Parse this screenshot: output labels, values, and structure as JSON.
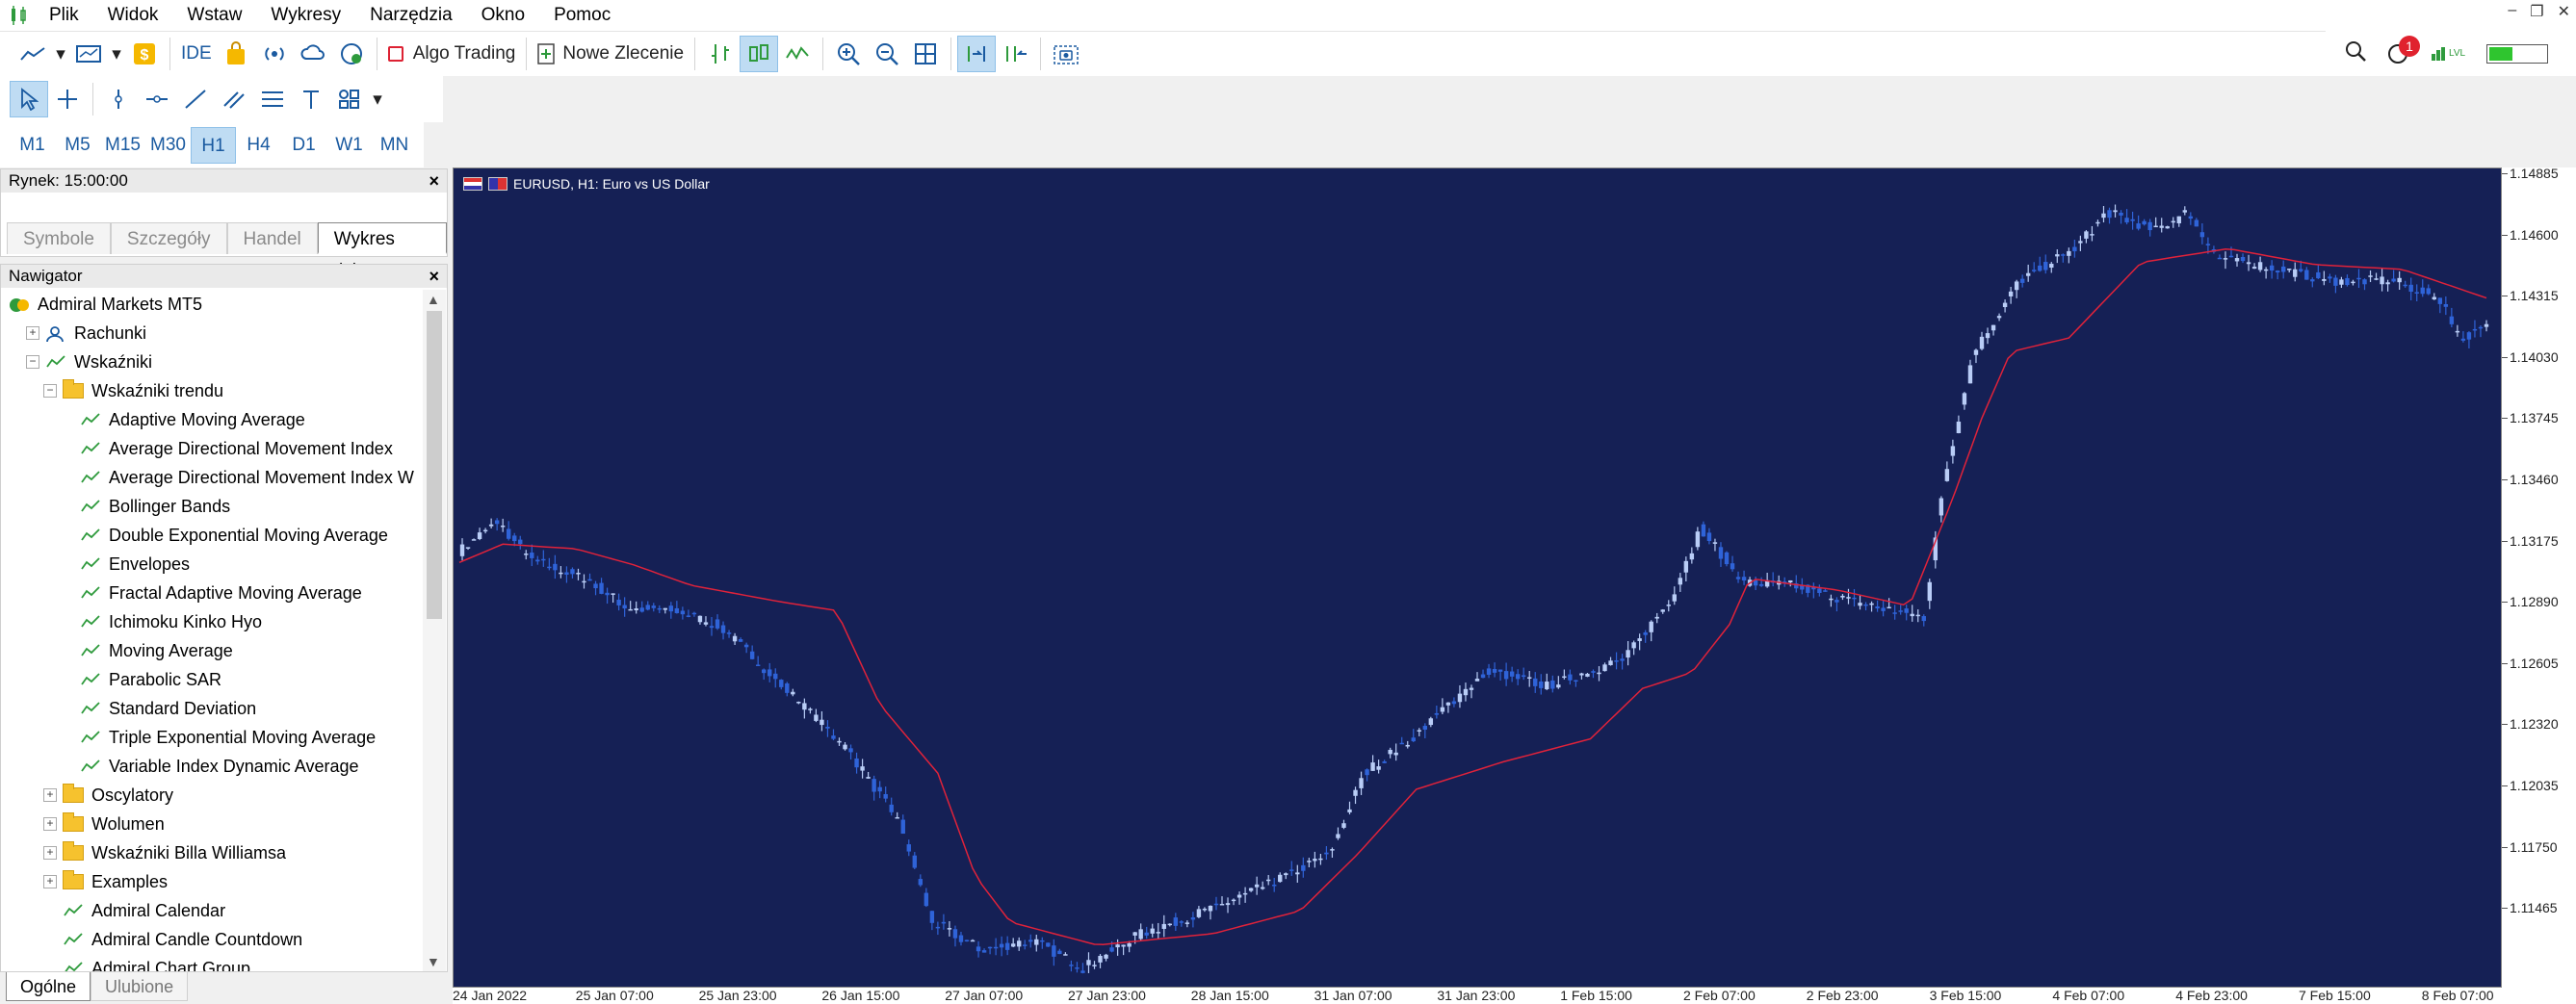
{
  "menu": [
    "Plik",
    "Widok",
    "Wstaw",
    "Wykresy",
    "Narzędzia",
    "Okno",
    "Pomoc"
  ],
  "toolbar": {
    "ide_label": "IDE",
    "algo_trading": "Algo Trading",
    "new_order": "Nowe Zlecenie",
    "notification_count": "1",
    "lvl_label": "LVL"
  },
  "timeframes": [
    "M1",
    "M5",
    "M15",
    "M30",
    "H1",
    "H4",
    "D1",
    "W1",
    "MN"
  ],
  "selected_timeframe": "H1",
  "market": {
    "title": "Rynek: 15:00:00",
    "tabs": [
      "Symbole",
      "Szczegóły",
      "Handel",
      "Wykres tickowy"
    ],
    "active_tab": "Wykres tickowy"
  },
  "navigator": {
    "title": "Nawigator",
    "root": "Admiral Markets MT5",
    "accounts": "Rachunki",
    "indicators": "Wskaźniki",
    "trend_folder": "Wskaźniki trendu",
    "trend_items": [
      "Adaptive Moving Average",
      "Average Directional Movement Index",
      "Average Directional Movement Index W",
      "Bollinger Bands",
      "Double Exponential Moving Average",
      "Envelopes",
      "Fractal Adaptive Moving Average",
      "Ichimoku Kinko Hyo",
      "Moving Average",
      "Parabolic SAR",
      "Standard Deviation",
      "Triple Exponential Moving Average",
      "Variable Index Dynamic Average"
    ],
    "folders": [
      "Oscylatory",
      "Wolumen",
      "Wskaźniki Billa Williamsa",
      "Examples"
    ],
    "extra_items": [
      "Admiral Calendar",
      "Admiral Candle Countdown",
      "Admiral Chart Group"
    ],
    "tabs": [
      "Ogólne",
      "Ulubione"
    ],
    "active_tab": "Ogólne"
  },
  "chart": {
    "title": "EURUSD, H1:  Euro vs US Dollar",
    "price_labels": [
      "1.14885",
      "1.14600",
      "1.14315",
      "1.14030",
      "1.13745",
      "1.13460",
      "1.13175",
      "1.12890",
      "1.12605",
      "1.12320",
      "1.12035",
      "1.11750",
      "1.11465"
    ],
    "time_labels": [
      "24 Jan 2022",
      "25 Jan 07:00",
      "25 Jan 23:00",
      "26 Jan 15:00",
      "27 Jan 07:00",
      "27 Jan 23:00",
      "28 Jan 15:00",
      "31 Jan 07:00",
      "31 Jan 23:00",
      "1 Feb 15:00",
      "2 Feb 07:00",
      "2 Feb 23:00",
      "3 Feb 15:00",
      "4 Feb 07:00",
      "4 Feb 23:00",
      "7 Feb 15:00",
      "8 Feb 07:00"
    ],
    "colors": {
      "background": "#152055",
      "bull": "#b9cdf7",
      "bear": "#2f63d8",
      "ma": "#e0223a"
    }
  },
  "chart_data": {
    "type": "candlestick",
    "title": "EURUSD, H1:  Euro vs US Dollar",
    "ylim": [
      1.1131,
      1.1489
    ],
    "series": [
      {
        "name": "EURUSD",
        "close_path": [
          [
            0,
            1.1322
          ],
          [
            13,
            1.1335
          ],
          [
            25,
            1.1318
          ],
          [
            45,
            1.1309
          ],
          [
            58,
            1.1297
          ],
          [
            75,
            1.1296
          ],
          [
            90,
            1.1289
          ],
          [
            110,
            1.1265
          ],
          [
            134,
            1.1235
          ],
          [
            152,
            1.1203
          ],
          [
            163,
            1.116
          ],
          [
            180,
            1.1148
          ],
          [
            198,
            1.1152
          ],
          [
            215,
            1.114
          ],
          [
            235,
            1.1155
          ],
          [
            260,
            1.1166
          ],
          [
            280,
            1.1177
          ],
          [
            300,
            1.119
          ],
          [
            312,
            1.1225
          ],
          [
            328,
            1.124
          ],
          [
            342,
            1.1256
          ],
          [
            355,
            1.127
          ],
          [
            375,
            1.1263
          ],
          [
            402,
            1.1275
          ],
          [
            418,
            1.1302
          ],
          [
            428,
            1.1332
          ],
          [
            443,
            1.1308
          ],
          [
            460,
            1.1307
          ],
          [
            480,
            1.13
          ],
          [
            505,
            1.1293
          ],
          [
            512,
            1.1353
          ],
          [
            522,
            1.1408
          ],
          [
            538,
            1.144
          ],
          [
            558,
            1.1455
          ],
          [
            568,
            1.147
          ],
          [
            585,
            1.1462
          ],
          [
            596,
            1.147
          ],
          [
            606,
            1.145
          ],
          [
            628,
            1.1445
          ],
          [
            645,
            1.144
          ],
          [
            667,
            1.144
          ],
          [
            683,
            1.1432
          ],
          [
            690,
            1.1415
          ],
          [
            700,
            1.142
          ]
        ]
      },
      {
        "name": "MA",
        "path": [
          [
            0,
            1.1317
          ],
          [
            15,
            1.1325
          ],
          [
            40,
            1.1323
          ],
          [
            60,
            1.1316
          ],
          [
            80,
            1.1307
          ],
          [
            110,
            1.13
          ],
          [
            130,
            1.1296
          ],
          [
            145,
            1.1255
          ],
          [
            165,
            1.1225
          ],
          [
            178,
            1.118
          ],
          [
            190,
            1.116
          ],
          [
            220,
            1.115
          ],
          [
            260,
            1.1155
          ],
          [
            290,
            1.1165
          ],
          [
            310,
            1.119
          ],
          [
            330,
            1.1218
          ],
          [
            360,
            1.123
          ],
          [
            390,
            1.124
          ],
          [
            408,
            1.1262
          ],
          [
            425,
            1.1269
          ],
          [
            438,
            1.129
          ],
          [
            445,
            1.131
          ],
          [
            475,
            1.1305
          ],
          [
            500,
            1.1298
          ],
          [
            515,
            1.1345
          ],
          [
            525,
            1.138
          ],
          [
            535,
            1.1409
          ],
          [
            555,
            1.1415
          ],
          [
            580,
            1.1448
          ],
          [
            610,
            1.1454
          ],
          [
            640,
            1.1447
          ],
          [
            670,
            1.1445
          ],
          [
            700,
            1.1432
          ]
        ]
      }
    ]
  }
}
